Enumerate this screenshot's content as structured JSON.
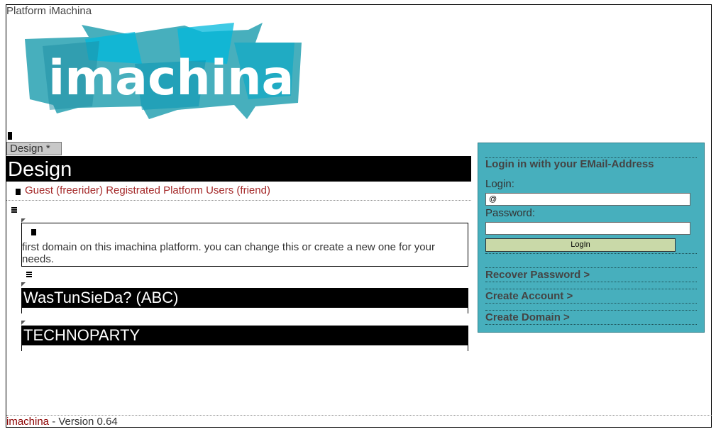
{
  "site": {
    "title": "Platform iMachina",
    "logo_text": "imachina"
  },
  "tab": {
    "label": "Design *"
  },
  "page": {
    "title": "Design"
  },
  "groups": {
    "text": "Guest (freerider) Registrated Platform Users (friend)"
  },
  "domain": {
    "description": "first domain on this imachina platform. you can change this or create a new one for your needs."
  },
  "domains_list": [
    {
      "label": "WasTunSieDa? (ABC)"
    },
    {
      "label": "TECHNOPARTY"
    }
  ],
  "login": {
    "heading": "Login in with your EMail-Address",
    "login_label": "Login:",
    "login_value": "@",
    "password_label": "Password:",
    "password_value": "",
    "button_label": "LogIn",
    "links": [
      "Recover Password >",
      "Create Account >",
      "Create Domain >"
    ]
  },
  "footer": {
    "brand": "imachina",
    "version": " - Version 0.64"
  },
  "colors": {
    "panel_bg": "#47afbd",
    "logo_dark": "#2a9bb0",
    "logo_light": "#00c0e0",
    "button_bg": "#c9d9a8",
    "link_red": "#a52a2a"
  }
}
